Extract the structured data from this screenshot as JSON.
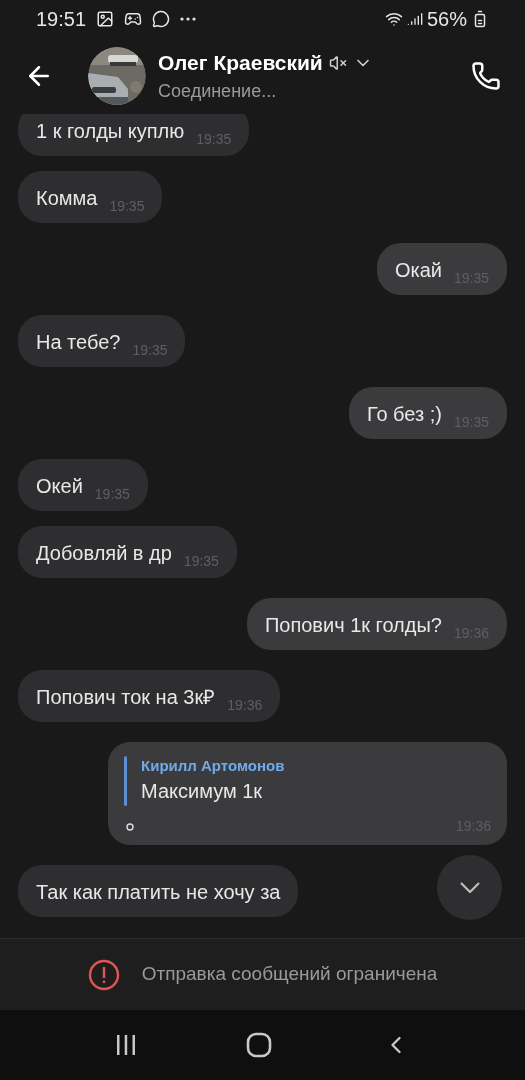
{
  "status_bar": {
    "time": "19:51",
    "battery": "56%"
  },
  "header": {
    "name": "Олег Краевский",
    "muted": true,
    "status": "Соединение..."
  },
  "messages": [
    {
      "kind": "text",
      "outgoing": false,
      "text": "1 к голды куплю",
      "time": "19:35"
    },
    {
      "kind": "text",
      "outgoing": false,
      "text": "Комма",
      "time": "19:35"
    },
    {
      "kind": "text",
      "outgoing": true,
      "text": "Окай",
      "time": "19:35"
    },
    {
      "kind": "text",
      "outgoing": false,
      "text": "На тебе?",
      "time": "19:35"
    },
    {
      "kind": "text",
      "outgoing": true,
      "text": "Го без ;)",
      "time": "19:35"
    },
    {
      "kind": "text",
      "outgoing": false,
      "text": "Окей",
      "time": "19:35"
    },
    {
      "kind": "text",
      "outgoing": false,
      "text": "Добовляй в др",
      "time": "19:35"
    },
    {
      "kind": "text",
      "outgoing": true,
      "text": "Попович 1к голды?",
      "time": "19:36"
    },
    {
      "kind": "text",
      "outgoing": false,
      "text": "Попович ток на 3к₽",
      "time": "19:36"
    },
    {
      "kind": "reply",
      "outgoing": true,
      "author": "Кирилл Артомонов",
      "text": "Максимум 1к",
      "time": "19:36"
    },
    {
      "kind": "text",
      "outgoing": false,
      "text": "Так как платить не хочу за"
    }
  ],
  "notice": "Отправка сообщений ограничена"
}
